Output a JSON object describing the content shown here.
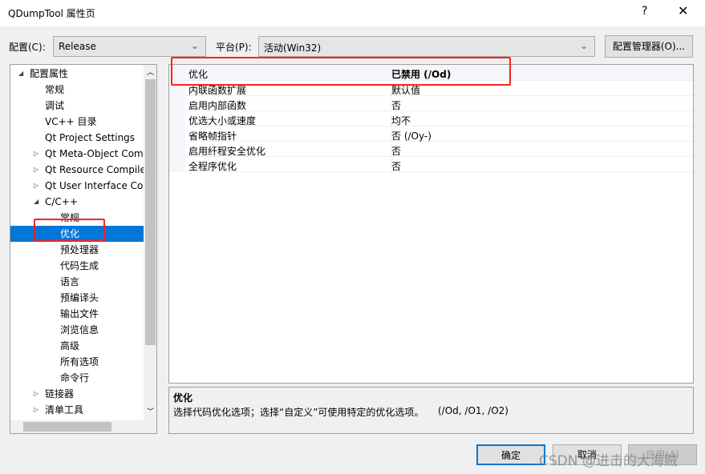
{
  "window": {
    "title": "QDumpTool 属性页",
    "help": "?",
    "close": "✕"
  },
  "config": {
    "label": "配置(C):",
    "value": "Release",
    "platform_label": "平台(P):",
    "platform_value": "活动(Win32)",
    "manager": "配置管理器(O)..."
  },
  "tree": [
    {
      "label": "配置属性",
      "level": 0,
      "expander": "expanded"
    },
    {
      "label": "常规",
      "level": 1
    },
    {
      "label": "调试",
      "level": 1
    },
    {
      "label": "VC++ 目录",
      "level": 1
    },
    {
      "label": "Qt Project Settings",
      "level": 1
    },
    {
      "label": "Qt Meta-Object Com",
      "level": 1,
      "expander": "collapsed"
    },
    {
      "label": "Qt Resource Compile",
      "level": 1,
      "expander": "collapsed"
    },
    {
      "label": "Qt User Interface Co",
      "level": 1,
      "expander": "collapsed"
    },
    {
      "label": "C/C++",
      "level": 1,
      "expander": "expanded"
    },
    {
      "label": "常规",
      "level": 2
    },
    {
      "label": "优化",
      "level": 2,
      "selected": true
    },
    {
      "label": "预处理器",
      "level": 2
    },
    {
      "label": "代码生成",
      "level": 2
    },
    {
      "label": "语言",
      "level": 2
    },
    {
      "label": "预编译头",
      "level": 2
    },
    {
      "label": "输出文件",
      "level": 2
    },
    {
      "label": "浏览信息",
      "level": 2
    },
    {
      "label": "高级",
      "level": 2
    },
    {
      "label": "所有选项",
      "level": 2
    },
    {
      "label": "命令行",
      "level": 2
    },
    {
      "label": "链接器",
      "level": 1,
      "expander": "collapsed"
    },
    {
      "label": "清单工具",
      "level": 1,
      "expander": "collapsed"
    }
  ],
  "grid": [
    {
      "name": "优化",
      "value": "已禁用 (/Od)",
      "selected": true
    },
    {
      "name": "内联函数扩展",
      "value": "默认值"
    },
    {
      "name": "启用内部函数",
      "value": "否"
    },
    {
      "name": "优选大小或速度",
      "value": "均不"
    },
    {
      "name": "省略帧指针",
      "value": "否 (/Oy-)"
    },
    {
      "name": "启用纤程安全优化",
      "value": "否"
    },
    {
      "name": "全程序优化",
      "value": "否"
    }
  ],
  "description": {
    "title": "优化",
    "text": "选择代码优化选项；选择“自定义”可使用特定的优化选项。",
    "switches": "(/Od, /O1, /O2)"
  },
  "buttons": {
    "ok": "确定",
    "cancel": "取消",
    "apply": "应用(A)"
  },
  "watermark": "CSDN @进击的大海贼",
  "colors": {
    "selection": "#0078d7",
    "highlight_box": "#ff2020"
  }
}
